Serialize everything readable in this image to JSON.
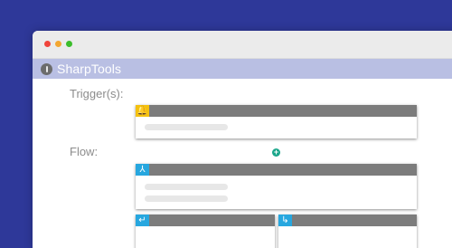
{
  "window": {
    "controls": [
      "close",
      "minimize",
      "maximize"
    ]
  },
  "app": {
    "title": "SharpTools",
    "icon": "power-icon"
  },
  "sections": {
    "trigger_label": "Trigger(s):",
    "flow_label": "Flow:"
  },
  "trigger_card": {
    "icon": "bell-icon",
    "icon_glyph": "🔔",
    "color": "#f4c10f"
  },
  "flow_card": {
    "icon": "fork-icon",
    "icon_glyph": "⅄",
    "color": "#27a7df"
  },
  "branch_cards": [
    {
      "icon": "return-arrow-icon",
      "icon_glyph": "↵",
      "color": "#27a7df"
    },
    {
      "icon": "down-right-arrow-icon",
      "icon_glyph": "↳",
      "color": "#27a7df"
    }
  ],
  "add_button": {
    "glyph": "+",
    "color": "#1aa68a"
  },
  "colors": {
    "background": "#2e3899",
    "appbar": "#b9bfe3",
    "card_header": "#7c7c7c"
  }
}
